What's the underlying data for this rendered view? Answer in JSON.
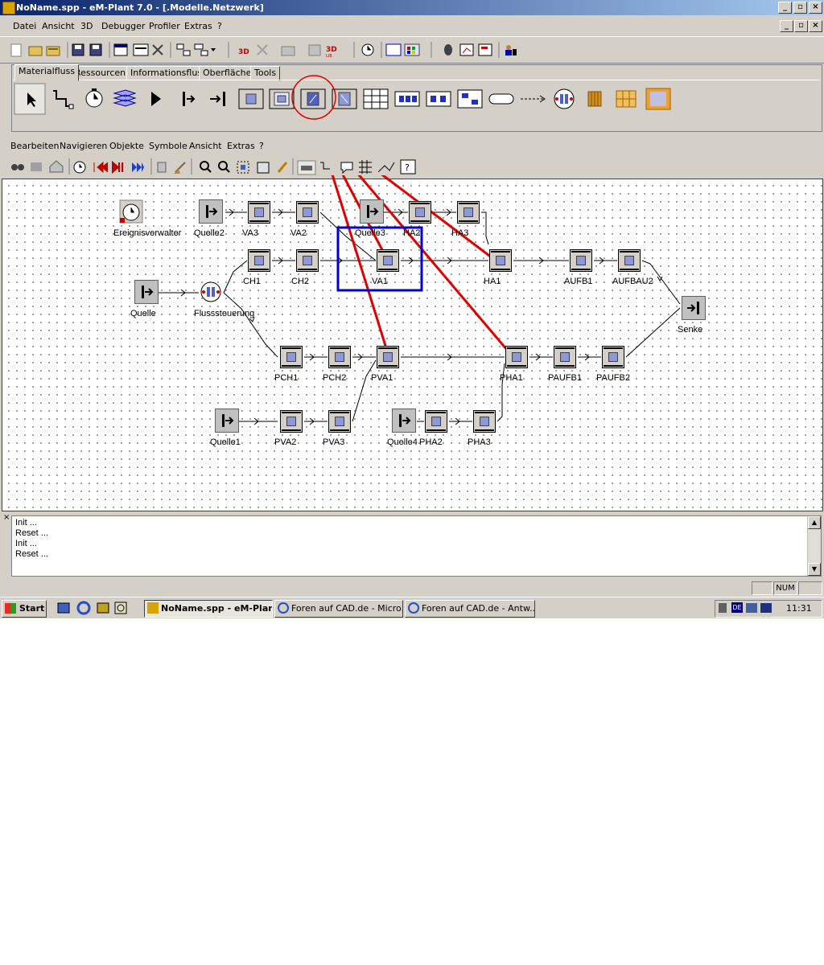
{
  "window": {
    "title": "NoName.spp - eM-Plant 7.0 - [.Modelle.Netzwerk]",
    "buttons": [
      "_",
      "▫",
      "×"
    ]
  },
  "menu": [
    "Datei",
    "Ansicht",
    "3D",
    "Debugger",
    "Profiler",
    "Extras",
    "?"
  ],
  "library_tabs": [
    "Materialfluss",
    "Ressourcen",
    "Informationsfluss",
    "Oberfläche",
    "Tools"
  ],
  "active_tab": "Materialfluss",
  "network_menu": [
    "Bearbeiten",
    "Navigieren",
    "Objekte",
    "Symbole",
    "Ansicht",
    "Extras",
    "?"
  ],
  "toolbar_labels": {
    "threed": "3D",
    "threed_lib": "3D",
    "threed_lib_sub": "LIB"
  },
  "model": {
    "event_controller": "Ereignisverwalter",
    "sources": [
      "Quelle",
      "Quelle1",
      "Quelle2",
      "Quelle3",
      "Quelle4"
    ],
    "flow_control": "Flusssteuerung",
    "sink": "Senke",
    "stations": {
      "va3": "VA3",
      "va2": "VA2",
      "ha2": "HA2",
      "ha3": "HA3",
      "ch1": "CH1",
      "ch2": "CH2",
      "va1": "VA1",
      "ha1": "HA1",
      "aufb1": "AUFB1",
      "aufbau2": "AUFBAU2",
      "pch1": "PCH1",
      "pch2": "PCH2",
      "pva1": "PVA1",
      "pha1": "PHA1",
      "paufb1": "PAUFB1",
      "paufb2": "PAUFB2",
      "pva2": "PVA2",
      "pva3": "PVA3",
      "pha2": "PHA2",
      "pha3": "PHA3"
    }
  },
  "log_lines": [
    "Init ...",
    "Reset ...",
    "Init ...",
    "Reset ..."
  ],
  "status": {
    "num": "NUM"
  },
  "taskbar": {
    "start": "Start",
    "tasks": [
      "NoName.spp - eM-Plan...",
      "Foren auf CAD.de - Micro...",
      "Foren auf CAD.de - Antw..."
    ],
    "lang": "DE",
    "clock": "11:31"
  },
  "colors": {
    "annotation": "#e00000",
    "highlight": "#0000cc",
    "block_inner": "#8c98d8"
  }
}
